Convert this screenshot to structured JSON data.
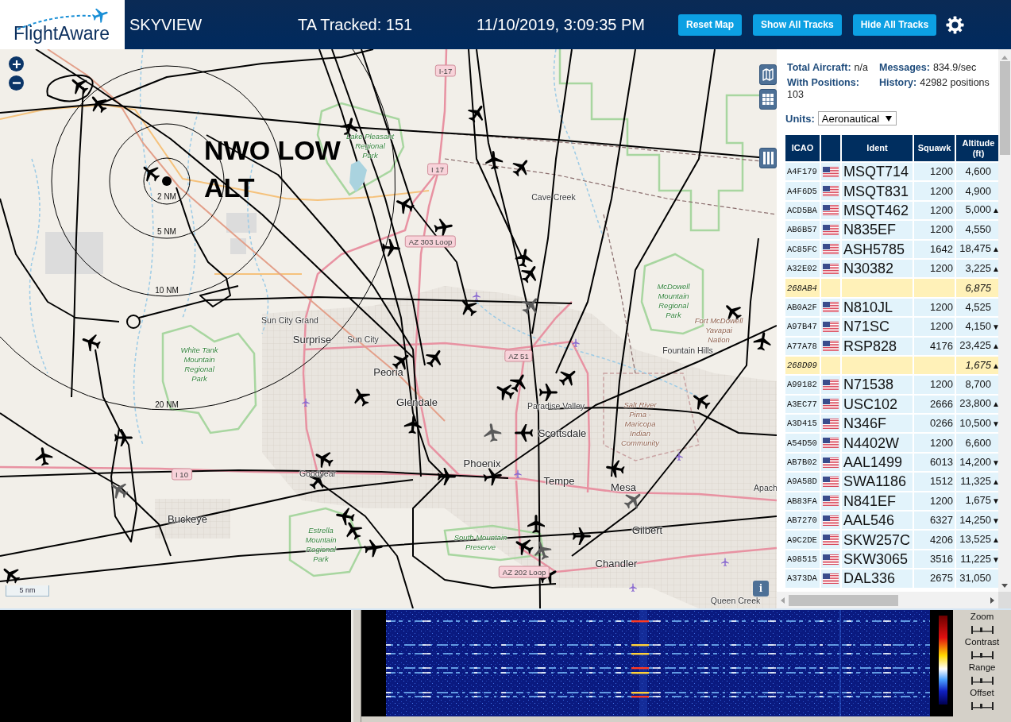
{
  "header": {
    "logo": "FlightAware",
    "title": "SKYVIEW",
    "tracked": "TA Tracked: 151",
    "datetime": "11/10/2019, 3:09:35 PM",
    "buttons": [
      "Reset Map",
      "Show All Tracks",
      "Hide All Tracks"
    ]
  },
  "map": {
    "overlay_label": "NWO LOW ALT",
    "range_rings": [
      "2 NM",
      "5 NM",
      "10 NM",
      "20 NM"
    ],
    "place_labels": [
      {
        "text": "I-17",
        "kind": "shield"
      },
      {
        "text": "Lake Pleasant\nRegional\nPark",
        "kind": "park"
      },
      {
        "text": "I 17",
        "kind": "shield"
      },
      {
        "text": "Cave Creek",
        "kind": "town"
      },
      {
        "text": "AZ 303 Loop",
        "kind": "shield"
      },
      {
        "text": "McDowell\nMountain\nRegional\nPark",
        "kind": "park"
      },
      {
        "text": "Sun City Grand",
        "kind": "town"
      },
      {
        "text": "Surprise",
        "kind": "city"
      },
      {
        "text": "Sun City",
        "kind": "town"
      },
      {
        "text": "Fort McDowell\nYavapai\nNation",
        "kind": "area"
      },
      {
        "text": "White Tank\nMountain\nRegional\nPark",
        "kind": "park"
      },
      {
        "text": "AZ 51",
        "kind": "shield"
      },
      {
        "text": "Fountain Hills",
        "kind": "town"
      },
      {
        "text": "Peoria",
        "kind": "city"
      },
      {
        "text": "Glendale",
        "kind": "city"
      },
      {
        "text": "Paradise Valley",
        "kind": "town"
      },
      {
        "text": "Scottsdale",
        "kind": "city"
      },
      {
        "text": "Salt River\nPima -\nMaricopa\nIndian\nCommunity",
        "kind": "area"
      },
      {
        "text": "I 10",
        "kind": "shield"
      },
      {
        "text": "Goodyear",
        "kind": "town"
      },
      {
        "text": "Phoenix",
        "kind": "city"
      },
      {
        "text": "Tempe",
        "kind": "city"
      },
      {
        "text": "Mesa",
        "kind": "city"
      },
      {
        "text": "Apach",
        "kind": "town"
      },
      {
        "text": "Buckeye",
        "kind": "city"
      },
      {
        "text": "Estrella\nMountain\nRegional\nPark",
        "kind": "park"
      },
      {
        "text": "South Mountain\nPreserve",
        "kind": "park"
      },
      {
        "text": "Gilbert",
        "kind": "city"
      },
      {
        "text": "AZ 202 Loop",
        "kind": "shield"
      },
      {
        "text": "Chandler",
        "kind": "city"
      },
      {
        "text": "Queen Creek",
        "kind": "town"
      }
    ],
    "scale": "5 nm",
    "info_button": "i"
  },
  "panel": {
    "stats": [
      {
        "label": "Total Aircraft:",
        "value": "n/a"
      },
      {
        "label": "Messages:",
        "value": "834.9/sec"
      },
      {
        "label": "With Positions:",
        "value": "103"
      },
      {
        "label": "History:",
        "value": "42982 positions"
      }
    ],
    "units": {
      "label": "Units:",
      "value": "Aeronautical"
    },
    "columns": [
      {
        "kind": "text",
        "label": "ICAO"
      },
      {
        "kind": "flag"
      },
      {
        "kind": "text",
        "label": "Ident"
      },
      {
        "kind": "text",
        "label": "Squawk"
      },
      {
        "kind": "text",
        "label": "Altitude (ft)"
      }
    ],
    "rows": [
      {
        "icao": "A4F179",
        "flag": true,
        "ident": "MSQT714",
        "squawk": "1200",
        "altitude": "4,600",
        "highlighted": false
      },
      {
        "icao": "A4F6D5",
        "flag": true,
        "ident": "MSQT831",
        "squawk": "1200",
        "altitude": "4,900",
        "highlighted": false
      },
      {
        "icao": "ACD5BA",
        "flag": true,
        "ident": "MSQT462",
        "squawk": "1200",
        "altitude": "5,000",
        "trend": "▲",
        "highlighted": false
      },
      {
        "icao": "AB6B57",
        "flag": true,
        "ident": "N835EF",
        "squawk": "1200",
        "altitude": "4,550",
        "highlighted": false
      },
      {
        "icao": "AC85FC",
        "flag": true,
        "ident": "ASH5785",
        "squawk": "1642",
        "altitude": "18,475",
        "trend": "▲",
        "highlighted": false
      },
      {
        "icao": "A32E02",
        "flag": true,
        "ident": "N30382",
        "squawk": "1200",
        "altitude": "3,225",
        "trend": "▲",
        "highlighted": false
      },
      {
        "icao": "268AB4",
        "flag": false,
        "altitude": "6,875",
        "highlighted": true
      },
      {
        "icao": "AB0A2F",
        "flag": true,
        "ident": "N810JL",
        "squawk": "1200",
        "altitude": "4,525",
        "highlighted": false
      },
      {
        "icao": "A97B47",
        "flag": true,
        "ident": "N71SC",
        "squawk": "1200",
        "altitude": "4,150",
        "trend": "▼",
        "highlighted": false
      },
      {
        "icao": "A77A78",
        "flag": true,
        "ident": "RSP828",
        "squawk": "4176",
        "altitude": "23,425",
        "trend": "▲",
        "highlighted": false
      },
      {
        "icao": "268D09",
        "flag": false,
        "altitude": "1,675",
        "trend": "▲",
        "highlighted": true
      },
      {
        "icao": "A99182",
        "flag": true,
        "ident": "N71538",
        "squawk": "1200",
        "altitude": "8,700",
        "highlighted": false
      },
      {
        "icao": "A3EC77",
        "flag": true,
        "ident": "USC102",
        "squawk": "2666",
        "altitude": "23,800",
        "trend": "▲",
        "highlighted": false
      },
      {
        "icao": "A3D415",
        "flag": true,
        "ident": "N346F",
        "squawk": "0266",
        "altitude": "10,500",
        "trend": "▼",
        "highlighted": false
      },
      {
        "icao": "A54D50",
        "flag": true,
        "ident": "N4402W",
        "squawk": "1200",
        "altitude": "6,600",
        "highlighted": false
      },
      {
        "icao": "AB7B02",
        "flag": true,
        "ident": "AAL1499",
        "squawk": "6013",
        "altitude": "14,200",
        "trend": "▼",
        "highlighted": false
      },
      {
        "icao": "A9A58D",
        "flag": true,
        "ident": "SWA1186",
        "squawk": "1512",
        "altitude": "11,325",
        "trend": "▲",
        "highlighted": false
      },
      {
        "icao": "AB83FA",
        "flag": true,
        "ident": "N841EF",
        "squawk": "1200",
        "altitude": "1,675",
        "trend": "▼",
        "highlighted": false
      },
      {
        "icao": "AB7270",
        "flag": true,
        "ident": "AAL546",
        "squawk": "6327",
        "altitude": "14,250",
        "trend": "▼",
        "highlighted": false
      },
      {
        "icao": "A9C2DE",
        "flag": true,
        "ident": "SKW257C",
        "squawk": "4206",
        "altitude": "13,525",
        "trend": "▲",
        "highlighted": false
      },
      {
        "icao": "A98515",
        "flag": true,
        "ident": "SKW3065",
        "squawk": "3516",
        "altitude": "11,225",
        "trend": "▼",
        "highlighted": false
      },
      {
        "icao": "A373DA",
        "flag": true,
        "ident": "DAL336",
        "squawk": "2675",
        "altitude": "31,050",
        "highlighted": false
      }
    ]
  },
  "spectrum": {
    "controls": [
      "Zoom",
      "Contrast",
      "Range",
      "Offset"
    ]
  }
}
